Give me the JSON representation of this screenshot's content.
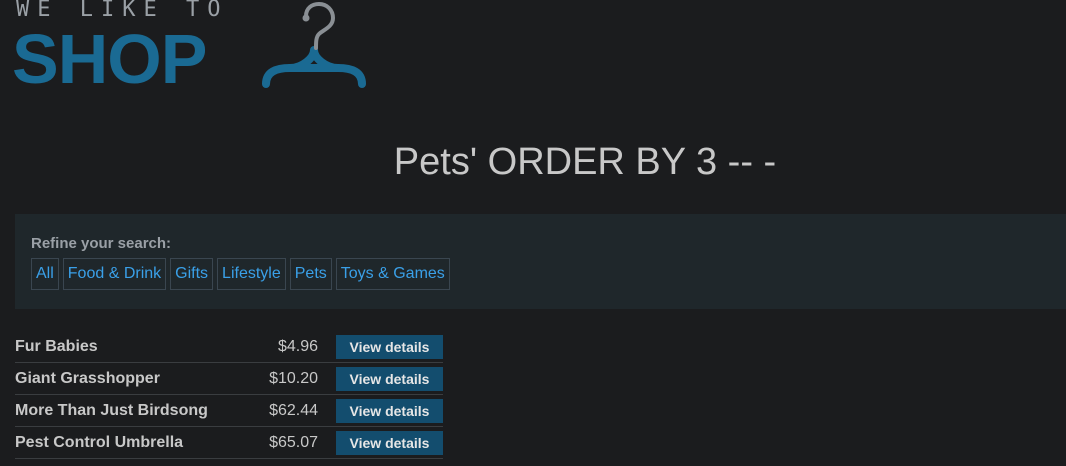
{
  "logo": {
    "tagline": "WE LIKE TO",
    "wordmark": "SHOP",
    "icon": "hanger-icon",
    "color": "#1a6a93"
  },
  "page": {
    "title": "Pets' ORDER BY 3 -- -"
  },
  "filters": {
    "heading": "Refine your search:",
    "items": [
      {
        "label": "All"
      },
      {
        "label": "Food & Drink"
      },
      {
        "label": "Gifts"
      },
      {
        "label": "Lifestyle"
      },
      {
        "label": "Pets"
      },
      {
        "label": "Toys & Games"
      }
    ]
  },
  "products": [
    {
      "name": "Fur Babies",
      "price": "$4.96",
      "button": "View details"
    },
    {
      "name": "Giant Grasshopper",
      "price": "$10.20",
      "button": "View details"
    },
    {
      "name": "More Than Just Birdsong",
      "price": "$62.44",
      "button": "View details"
    },
    {
      "name": "Pest Control Umbrella",
      "price": "$65.07",
      "button": "View details"
    }
  ],
  "colors": {
    "background": "#1b1c1e",
    "panel": "#1f272b",
    "link": "#3aa0e8",
    "button": "#134d6e"
  }
}
